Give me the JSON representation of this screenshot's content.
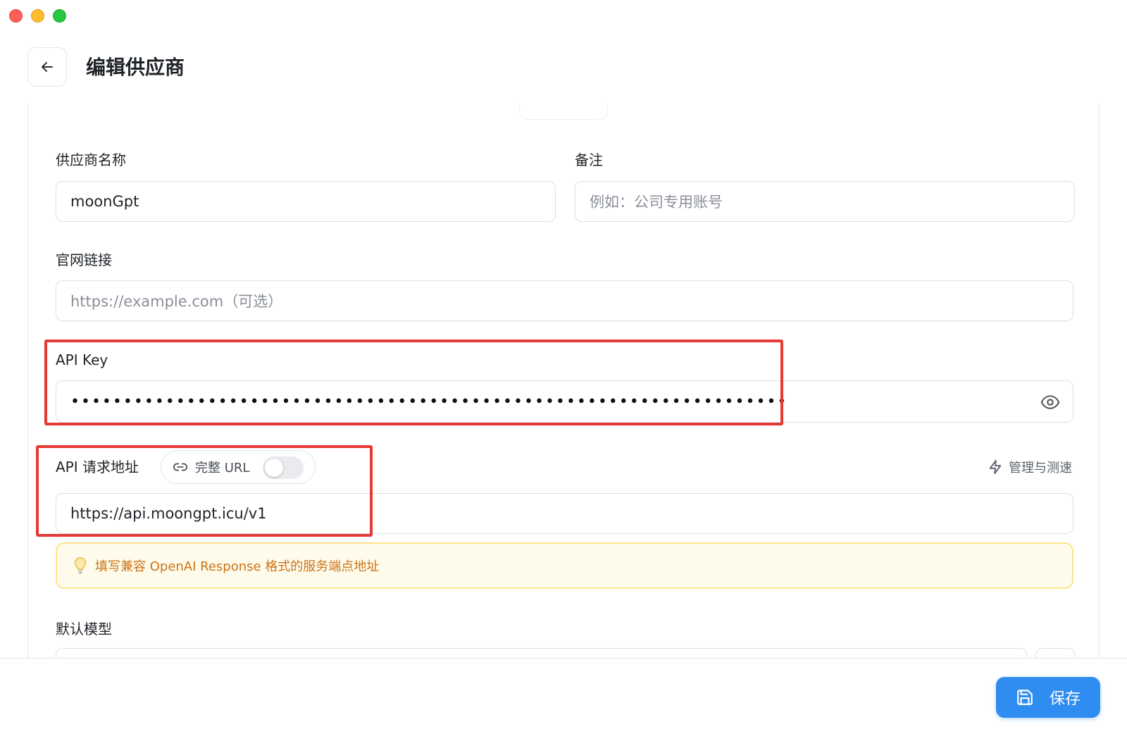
{
  "window": {
    "controls": [
      "close",
      "minimize",
      "zoom"
    ]
  },
  "header": {
    "back_icon": "arrow-left-icon",
    "title": "编辑供应商"
  },
  "form": {
    "provider_name": {
      "label": "供应商名称",
      "value": "moonGpt"
    },
    "notes": {
      "label": "备注",
      "placeholder": "例如：公司专用账号"
    },
    "website": {
      "label": "官网链接",
      "placeholder": "https://example.com（可选）"
    },
    "api_key": {
      "label": "API Key",
      "masked_value": "••••••••••••••••••••••••••••••••••••••••••••••••••••••••••••••••••••",
      "visibility_icon": "eye-icon"
    },
    "api_url": {
      "label": "API 请求地址",
      "full_url_toggle": {
        "icon": "link-icon",
        "label": "完整 URL",
        "on": false
      },
      "manage_link": {
        "icon": "lightning-icon",
        "label": "管理与测速"
      },
      "value": "https://api.moongpt.icu/v1",
      "hint": {
        "icon": "lightbulb-icon",
        "text": "填写兼容 OpenAI Response 格式的服务端点地址"
      }
    },
    "default_model": {
      "label": "默认模型"
    }
  },
  "footer": {
    "save_icon": "save-icon",
    "save_label": "保存"
  },
  "colors": {
    "accent": "#2f8cf0",
    "highlight": "#e53935",
    "hint_background": "#fffbea",
    "hint_border": "#fde58a",
    "hint_text": "#c9741a"
  }
}
